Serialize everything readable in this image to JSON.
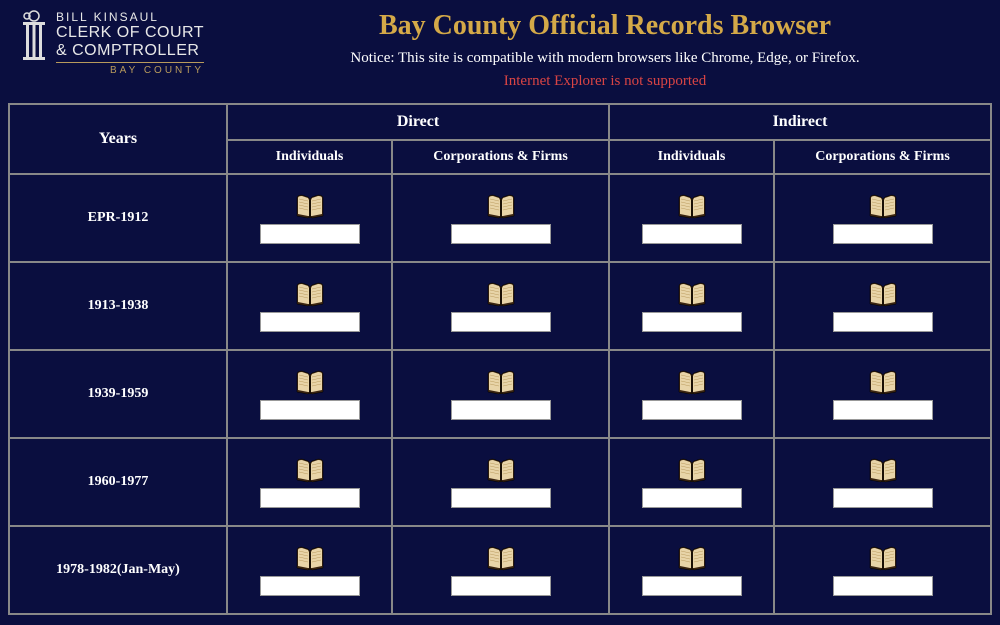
{
  "logo": {
    "name": "BILL KINSAUL",
    "title_line1": "CLERK OF COURT",
    "title_line2": "& COMPTROLLER",
    "county": "BAY COUNTY"
  },
  "header": {
    "title": "Bay County Official Records Browser",
    "notice": "Notice: This site is compatible with modern browsers like Chrome, Edge, or Firefox.",
    "warning": "Internet Explorer is not supported"
  },
  "table": {
    "years_header": "Years",
    "direct_header": "Direct",
    "indirect_header": "Indirect",
    "individuals_header": "Individuals",
    "corporations_header": "Corporations & Firms",
    "rows": [
      {
        "year": "EPR-1912"
      },
      {
        "year": "1913-1938"
      },
      {
        "year": "1939-1959"
      },
      {
        "year": "1960-1977"
      },
      {
        "year": "1978-1982(Jan-May)"
      }
    ]
  }
}
